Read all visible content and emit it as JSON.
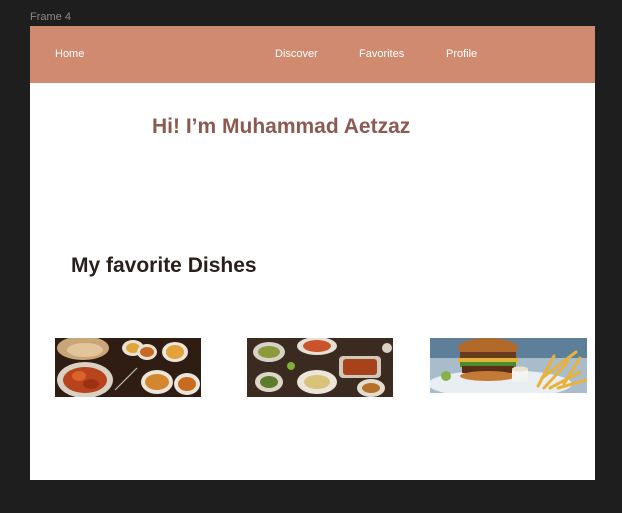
{
  "frame": {
    "label": "Frame 4"
  },
  "nav": {
    "home": "Home",
    "discover": "Discover",
    "favorites": "Favorites",
    "profile": "Profile"
  },
  "hero": {
    "greeting": "Hi! I’m Muhammad Aetzaz"
  },
  "favorites_section": {
    "title": "My favorite Dishes",
    "dishes": [
      {
        "image": "curry-and-naan-spread"
      },
      {
        "image": "table-of-shared-dishes"
      },
      {
        "image": "burger-and-fries"
      }
    ]
  },
  "colors": {
    "canvas": "#1e1e1e",
    "navbar": "#d08a6f",
    "greeting": "#8d5a52",
    "section_title": "#2a1f1d"
  }
}
